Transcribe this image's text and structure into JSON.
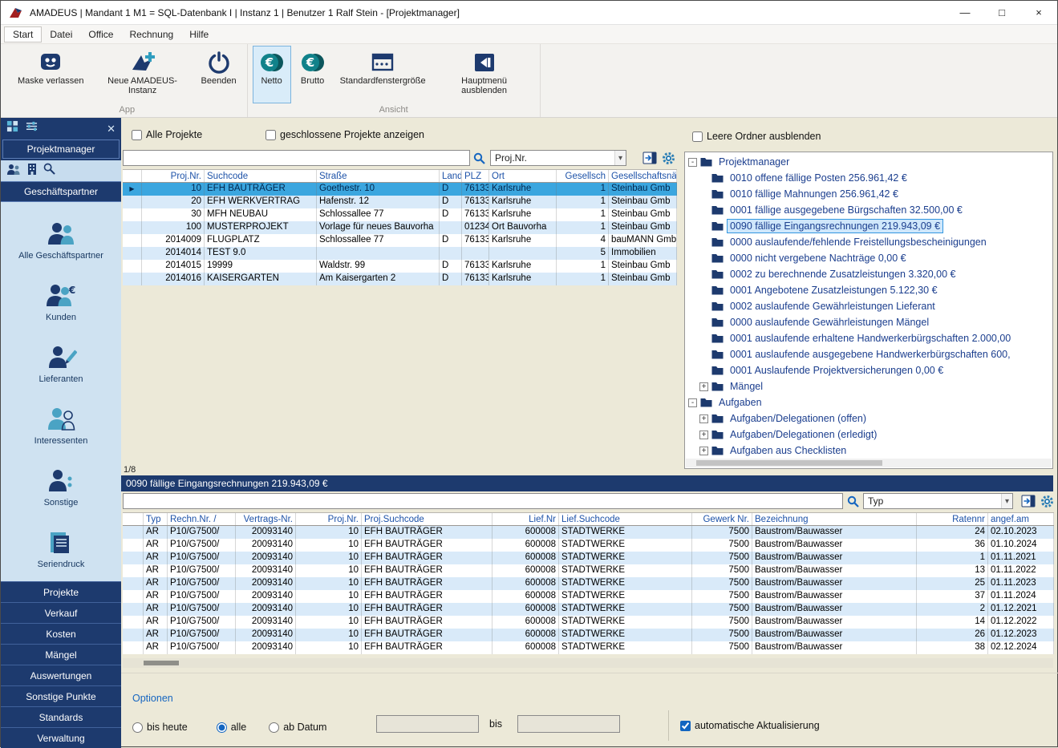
{
  "window": {
    "title": "AMADEUS | Mandant 1 M1 = SQL-Datenbank I | Instanz 1 | Benutzer 1 Ralf Stein - [Projektmanager]",
    "controls": {
      "minimize": "—",
      "maximize": "□",
      "close": "×"
    }
  },
  "menubar": [
    "Start",
    "Datei",
    "Office",
    "Rechnung",
    "Hilfe"
  ],
  "ribbon": {
    "groups": [
      {
        "label": "App",
        "buttons": [
          {
            "label": "Maske verlassen",
            "icon": "mask-icon"
          },
          {
            "label": "Neue AMADEUS-Instanz",
            "icon": "new-instance-icon"
          },
          {
            "label": "Beenden",
            "icon": "power-icon"
          }
        ]
      },
      {
        "label": "Ansicht",
        "buttons": [
          {
            "label": "Netto",
            "icon": "euro-coin-icon",
            "active": true
          },
          {
            "label": "Brutto",
            "icon": "euro-coin-icon"
          },
          {
            "label": "Standardfenstergröße",
            "icon": "window-size-icon"
          },
          {
            "label": "Hauptmenü ausblenden",
            "icon": "hide-menu-icon"
          }
        ]
      }
    ]
  },
  "sidebar": {
    "module_button": "Projektmanager",
    "section_button": "Geschäftspartner",
    "partner_items": [
      {
        "label": "Alle Geschäftspartner",
        "icon": "partners-icon"
      },
      {
        "label": "Kunden",
        "icon": "customers-icon"
      },
      {
        "label": "Lieferanten",
        "icon": "suppliers-icon"
      },
      {
        "label": "Interessenten",
        "icon": "prospects-icon"
      },
      {
        "label": "Sonstige",
        "icon": "others-icon"
      },
      {
        "label": "Seriendruck",
        "icon": "mailmerge-icon"
      }
    ],
    "nav_items": [
      "Projekte",
      "Verkauf",
      "Kosten",
      "Mängel",
      "Auswertungen",
      "Sonstige Punkte",
      "Standards",
      "Verwaltung"
    ]
  },
  "projects_panel": {
    "checkbox_all": "Alle Projekte",
    "checkbox_closed": "geschlossene Projekte anzeigen",
    "search_value": "",
    "filter_field": "Proj.Nr.",
    "columns": [
      "Proj.Nr.",
      "Suchcode",
      "Straße",
      "Land",
      "PLZ",
      "Ort",
      "Gesellsch",
      "Gesellschaftsnä"
    ],
    "rows": [
      [
        "10",
        "EFH BAUTRÄGER",
        "Goethestr. 10",
        "D",
        "76133",
        "Karlsruhe",
        "1",
        "Steinbau Gmb"
      ],
      [
        "20",
        "EFH WERKVERTRAG",
        "Hafenstr. 12",
        "D",
        "76133",
        "Karlsruhe",
        "1",
        "Steinbau Gmb"
      ],
      [
        "30",
        "MFH NEUBAU",
        "Schlossallee 77",
        "D",
        "76133",
        "Karlsruhe",
        "1",
        "Steinbau Gmb"
      ],
      [
        "100",
        "MUSTERPROJEKT",
        "Vorlage für neues Bauvorha",
        "",
        "01234",
        "Ort Bauvorha",
        "1",
        "Steinbau Gmb"
      ],
      [
        "2014009",
        "FLUGPLATZ",
        "Schlossallee 77",
        "D",
        "76133",
        "Karlsruhe",
        "4",
        "bauMANN Gmb"
      ],
      [
        "2014014",
        "TEST 9.0",
        "",
        "",
        "",
        "",
        "5",
        "Immobilien"
      ],
      [
        "2014015",
        "19999",
        "Waldstr. 99",
        "D",
        "76133",
        "Karlsruhe",
        "1",
        "Steinbau Gmb"
      ],
      [
        "2014016",
        "KAISERGARTEN",
        "Am Kaisergarten 2",
        "D",
        "76133",
        "Karlsruhe",
        "1",
        "Steinbau Gmb"
      ]
    ],
    "selected_row": 0,
    "pager": "1/8"
  },
  "tree_panel": {
    "checkbox_label": "Leere Ordner ausblenden",
    "tree": [
      {
        "label": "Projektmanager",
        "expanded": true,
        "children": [
          {
            "label": "0010 offene fällige Posten 256.961,42 €"
          },
          {
            "label": "0010 fällige Mahnungen 256.961,42 €"
          },
          {
            "label": "0001 fällige ausgegebene Bürgschaften 32.500,00 €"
          },
          {
            "label": "0090 fällige Eingangsrechnungen 219.943,09 €",
            "selected": true
          },
          {
            "label": "0000 auslaufende/fehlende Freistellungsbescheinigungen"
          },
          {
            "label": "0000 nicht vergebene Nachträge 0,00 €"
          },
          {
            "label": "0002 zu berechnende Zusatzleistungen 3.320,00 €"
          },
          {
            "label": "0001 Angebotene Zusatzleistungen 5.122,30 €"
          },
          {
            "label": "0002 auslaufende Gewährleistungen Lieferant"
          },
          {
            "label": "0000 auslaufende Gewährleistungen Mängel"
          },
          {
            "label": "0001 auslaufende erhaltene Handwerkerbürgschaften 2.000,00"
          },
          {
            "label": "0001 auslaufende ausgegebene Handwerkerbürgschaften 600,"
          },
          {
            "label": "0001 Auslaufende Projektversicherungen 0,00 €"
          },
          {
            "label": "Mängel",
            "expandable": true
          }
        ]
      },
      {
        "label": "Aufgaben",
        "expanded": true,
        "children": [
          {
            "label": "Aufgaben/Delegationen (offen)",
            "expandable": true
          },
          {
            "label": "Aufgaben/Delegationen (erledigt)",
            "expandable": true
          },
          {
            "label": "Aufgaben aus Checklisten",
            "expandable": true
          }
        ]
      }
    ]
  },
  "invoice_panel": {
    "header": "0090 fällige Eingangsrechnungen 219.943,09 €",
    "search_value": "",
    "filter_field": "Typ",
    "columns": [
      "Typ",
      "Rechn.Nr. /",
      "Vertrags-Nr.",
      "Proj.Nr.",
      "Proj.Suchcode",
      "Lief.Nr",
      "Lief.Suchcode",
      "Gewerk Nr.",
      "Bezeichnung",
      "Ratennr",
      "angef.am"
    ],
    "rows": [
      [
        "AR",
        "P10/G7500/",
        "20093140",
        "10",
        "EFH BAUTRÄGER",
        "600008",
        "STADTWERKE",
        "7500",
        "Baustrom/Bauwasser",
        "24",
        "02.10.2023"
      ],
      [
        "AR",
        "P10/G7500/",
        "20093140",
        "10",
        "EFH BAUTRÄGER",
        "600008",
        "STADTWERKE",
        "7500",
        "Baustrom/Bauwasser",
        "36",
        "01.10.2024"
      ],
      [
        "AR",
        "P10/G7500/",
        "20093140",
        "10",
        "EFH BAUTRÄGER",
        "600008",
        "STADTWERKE",
        "7500",
        "Baustrom/Bauwasser",
        "1",
        "01.11.2021"
      ],
      [
        "AR",
        "P10/G7500/",
        "20093140",
        "10",
        "EFH BAUTRÄGER",
        "600008",
        "STADTWERKE",
        "7500",
        "Baustrom/Bauwasser",
        "13",
        "01.11.2022"
      ],
      [
        "AR",
        "P10/G7500/",
        "20093140",
        "10",
        "EFH BAUTRÄGER",
        "600008",
        "STADTWERKE",
        "7500",
        "Baustrom/Bauwasser",
        "25",
        "01.11.2023"
      ],
      [
        "AR",
        "P10/G7500/",
        "20093140",
        "10",
        "EFH BAUTRÄGER",
        "600008",
        "STADTWERKE",
        "7500",
        "Baustrom/Bauwasser",
        "37",
        "01.11.2024"
      ],
      [
        "AR",
        "P10/G7500/",
        "20093140",
        "10",
        "EFH BAUTRÄGER",
        "600008",
        "STADTWERKE",
        "7500",
        "Baustrom/Bauwasser",
        "2",
        "01.12.2021"
      ],
      [
        "AR",
        "P10/G7500/",
        "20093140",
        "10",
        "EFH BAUTRÄGER",
        "600008",
        "STADTWERKE",
        "7500",
        "Baustrom/Bauwasser",
        "14",
        "01.12.2022"
      ],
      [
        "AR",
        "P10/G7500/",
        "20093140",
        "10",
        "EFH BAUTRÄGER",
        "600008",
        "STADTWERKE",
        "7500",
        "Baustrom/Bauwasser",
        "26",
        "01.12.2023"
      ],
      [
        "AR",
        "P10/G7500/",
        "20093140",
        "10",
        "EFH BAUTRÄGER",
        "600008",
        "STADTWERKE",
        "7500",
        "Baustrom/Bauwasser",
        "38",
        "02.12.2024"
      ]
    ]
  },
  "options": {
    "title": "Optionen",
    "radios": [
      {
        "label": "bis heute",
        "checked": false
      },
      {
        "label": "alle",
        "checked": true
      },
      {
        "label": "ab Datum",
        "checked": false
      }
    ],
    "between_label": "bis",
    "date_from": "",
    "date_to": "",
    "auto_refresh_label": "automatische Aktualisierung",
    "auto_refresh_checked": true
  }
}
